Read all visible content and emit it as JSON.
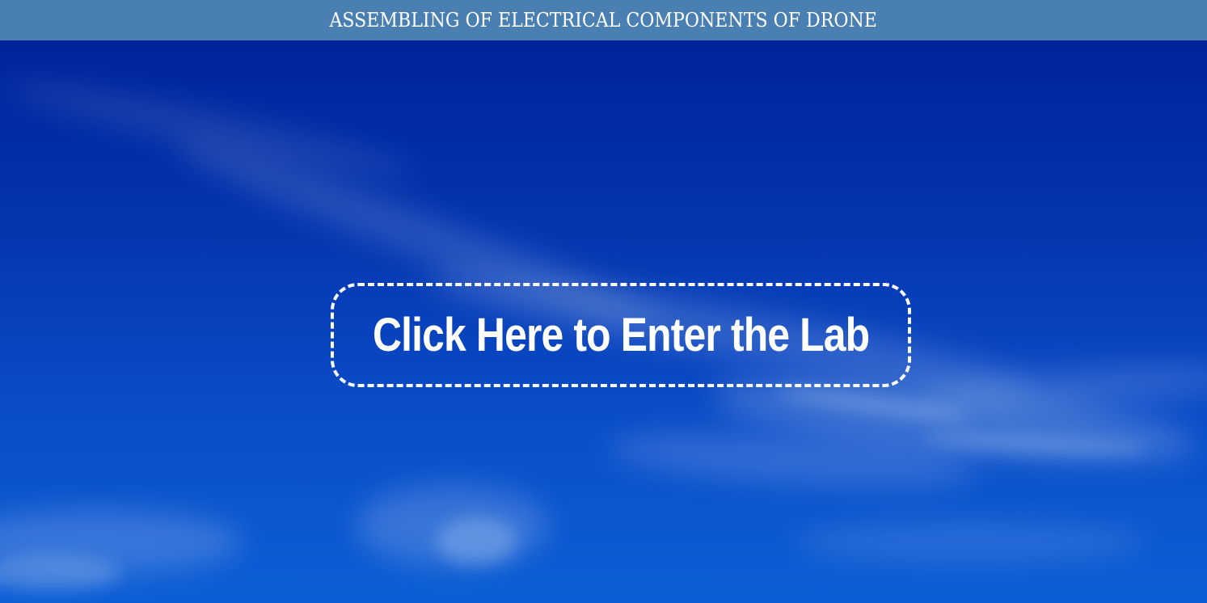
{
  "header": {
    "title": "ASSEMBLING OF ELECTRICAL COMPONENTS OF DRONE"
  },
  "main": {
    "enter_button_label": "Click Here to Enter the Lab"
  },
  "colors": {
    "header_bar": "#4a80b1",
    "sky_top": "#00239a",
    "sky_bottom": "#0d5ed6",
    "text": "#ffffff"
  }
}
